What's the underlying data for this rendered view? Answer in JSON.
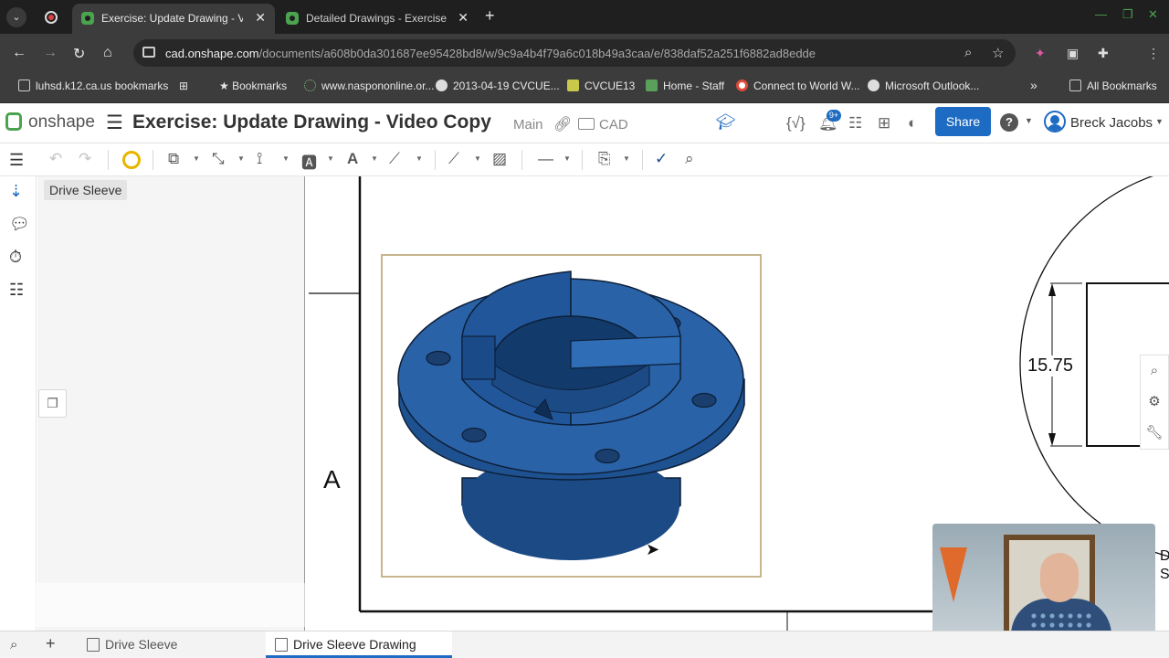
{
  "browser": {
    "tabs": [
      {
        "title": "Exercise: Update Drawing - Vid",
        "active": true
      },
      {
        "title": "Detailed Drawings - Exercise: U",
        "active": false
      }
    ],
    "new_tab": "+",
    "close_glyph": "✕",
    "url_host": "cad.onshape.com",
    "url_path": "/documents/a608b0da301687ee95428bd8/w/9c9a4b4f79a6c018b49a3caa/e/838daf52a251f6882ad8edde",
    "bookmarks": [
      "luhsd.k12.ca.us bookmarks",
      "Bookmarks",
      "www.naspononline.or...",
      "2013-04-19 CVCUE...",
      "CVCUE13",
      "Home - Staff",
      "Connect to World W...",
      "Microsoft Outlook..."
    ],
    "all_bookmarks": "All Bookmarks",
    "more": "»"
  },
  "onshape": {
    "logo": "onshape",
    "doc_title": "Exercise: Update Drawing - Video Copy",
    "branch": "Main",
    "folder": "CAD",
    "notif_count": "9+",
    "share_label": "Share",
    "help": "?",
    "user_name": "Breck Jacobs"
  },
  "panel": {
    "title": "Drive Sleeve"
  },
  "drawing": {
    "view_label": "A",
    "dimension": "15.75",
    "cutoff_text": [
      "DE",
      "SC"
    ]
  },
  "bottom_tabs": [
    {
      "label": "Drive Sleeve",
      "active": false
    },
    {
      "label": "Drive Sleeve Drawing",
      "active": true
    }
  ],
  "colors": {
    "part_blue": "#2a62a8",
    "part_dark": "#1b4a85",
    "brand_green": "#4ca34f",
    "accent_blue": "#1d6bc2",
    "view_frame": "#c8b58f"
  }
}
